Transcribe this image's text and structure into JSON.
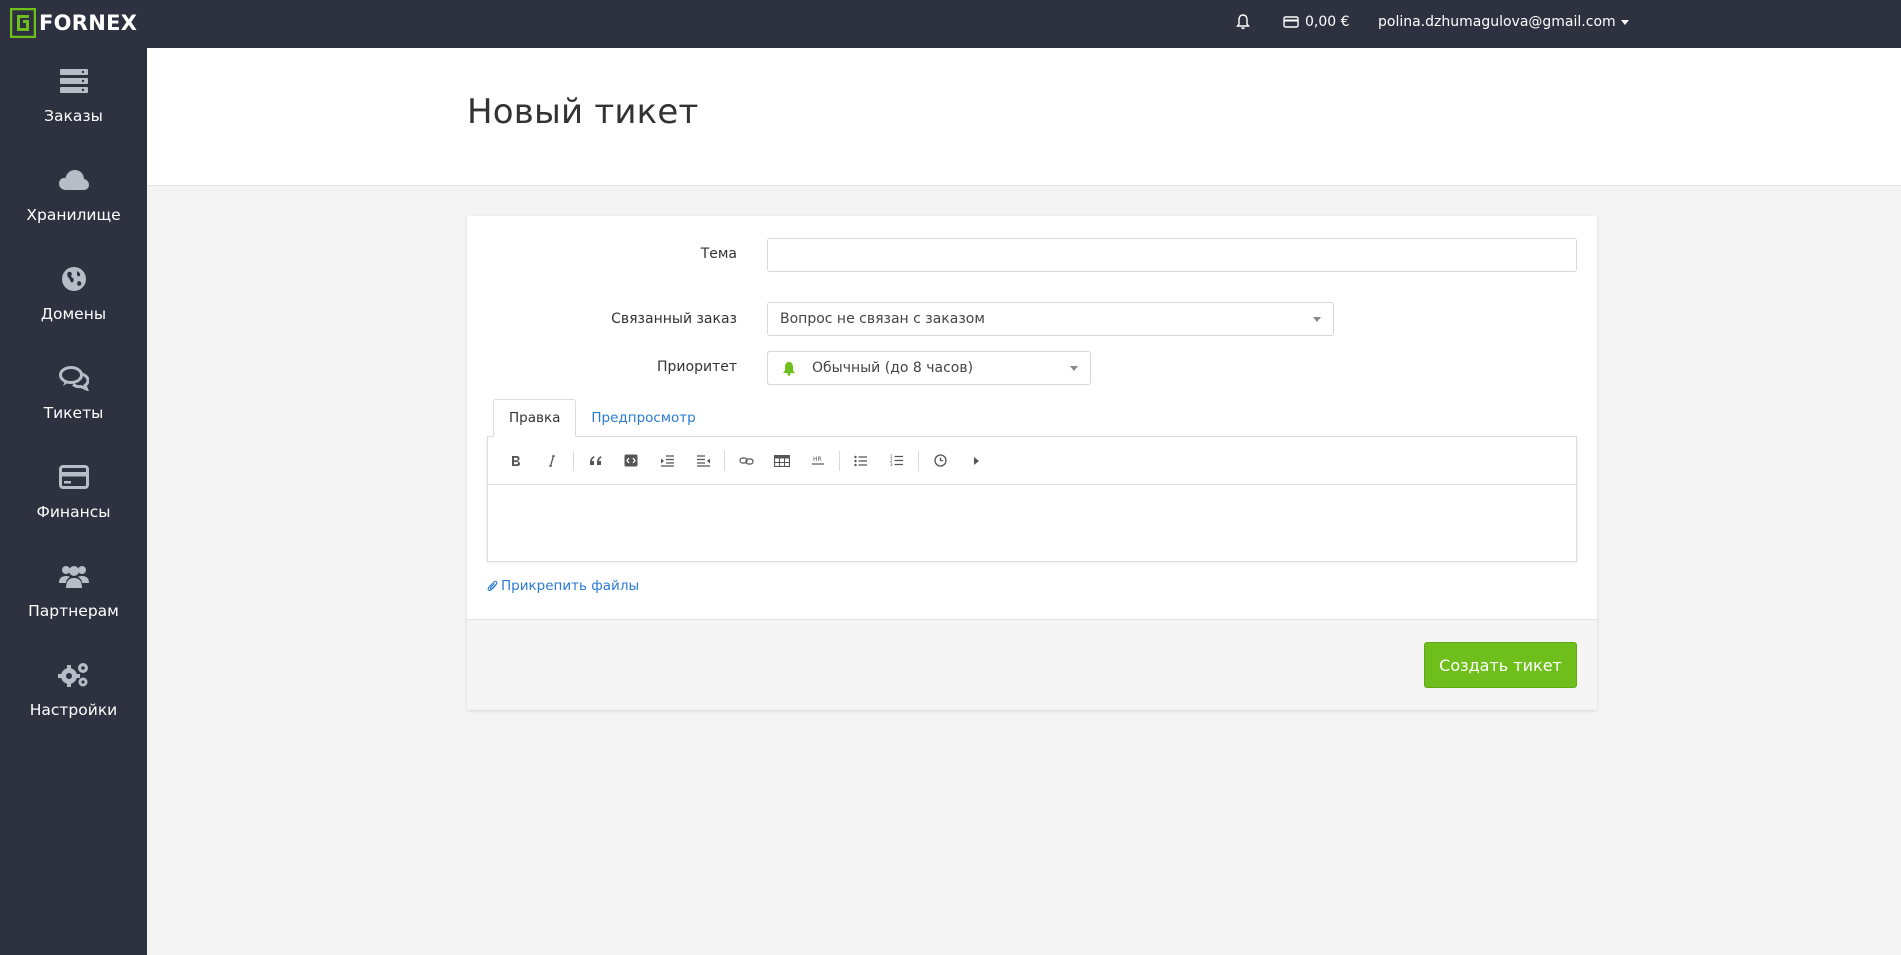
{
  "brand": {
    "name": "FORNEX",
    "accent": "#6fbf1c"
  },
  "topbar": {
    "balance": "0,00 €",
    "user_email": "polina.dzhumagulova@gmail.com"
  },
  "sidebar": {
    "items": [
      {
        "label": "Заказы",
        "icon": "server-icon"
      },
      {
        "label": "Хранилище",
        "icon": "cloud-icon"
      },
      {
        "label": "Домены",
        "icon": "globe-icon"
      },
      {
        "label": "Тикеты",
        "icon": "chat-icon"
      },
      {
        "label": "Финансы",
        "icon": "credit-card-icon"
      },
      {
        "label": "Партнерам",
        "icon": "users-icon"
      },
      {
        "label": "Настройки",
        "icon": "cogs-icon"
      }
    ]
  },
  "page": {
    "title": "Новый тикет"
  },
  "form": {
    "subject_label": "Тема",
    "subject_value": "",
    "order_label": "Связанный заказ",
    "order_value": "Вопрос не связан с заказом",
    "priority_label": "Приоритет",
    "priority_value": "Обычный (до 8 часов)"
  },
  "editor": {
    "tabs": [
      {
        "label": "Правка",
        "active": true
      },
      {
        "label": "Предпросмотр",
        "active": false
      }
    ],
    "content": ""
  },
  "attach_label": "Прикрепить файлы",
  "submit_label": "Создать тикет"
}
